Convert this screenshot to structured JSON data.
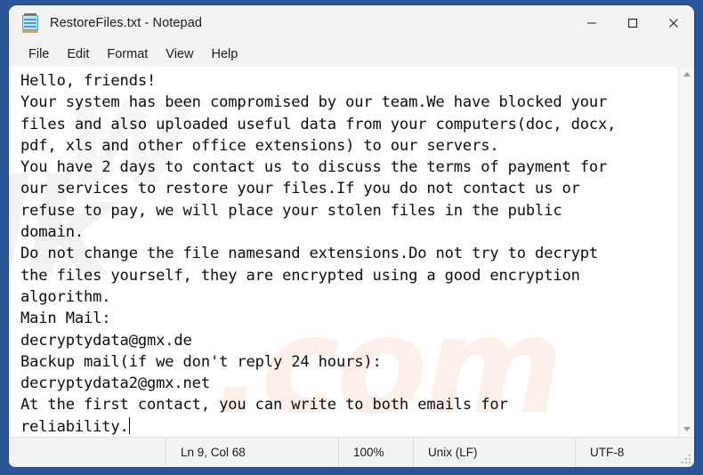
{
  "window": {
    "title": "RestoreFiles.txt - Notepad",
    "app_icon": "notepad-icon",
    "controls": {
      "minimize": "minimize-icon",
      "maximize": "maximize-icon",
      "close": "close-icon"
    }
  },
  "menubar": {
    "items": [
      {
        "label": "File"
      },
      {
        "label": "Edit"
      },
      {
        "label": "Format"
      },
      {
        "label": "View"
      },
      {
        "label": "Help"
      }
    ]
  },
  "editor": {
    "content": "Hello, friends!\nYour system has been compromised by our team.We have blocked your files and also uploaded useful data from your computers(doc, docx, pdf, xls and other office extensions) to our servers.\nYou have 2 days to contact us to discuss the terms of payment for our services to restore your files.If you do not contact us or refuse to pay, we will place your stolen files in the public domain.\nDo not change the file namesand extensions.Do not try to decrypt the files yourself, they are encrypted using a good encryption algorithm.\nMain Mail:\ndecryptydata@gmx.de\nBackup mail(if we don't reply 24 hours):\ndecryptydata2@gmx.net\nAt the first contact, you can write to both emails for reliability.",
    "wrapped_lines": [
      "Hello, friends!",
      "Your system has been compromised by our team.We have blocked your",
      "files and also uploaded useful data from your computers(doc, docx,",
      "pdf, xls and other office extensions) to our servers.",
      "You have 2 days to contact us to discuss the terms of payment for",
      "our services to restore your files.If you do not contact us or",
      "refuse to pay, we will place your stolen files in the public",
      "domain.",
      "Do not change the file namesand extensions.Do not try to decrypt",
      "the files yourself, they are encrypted using a good encryption",
      "algorithm.",
      "Main Mail:",
      "decryptydata@gmx.de",
      "Backup mail(if we don't reply 24 hours):",
      "decryptydata2@gmx.net",
      "At the first contact, you can write to both emails for",
      "reliability."
    ],
    "watermark": {
      "text_a": "lk",
      "text_b": ".com",
      "text_c": "W"
    }
  },
  "scrollbar": {
    "up_arrow": "scroll-up-icon",
    "down_arrow": "scroll-down-icon"
  },
  "statusbar": {
    "line_col": "Ln 9, Col 68",
    "zoom": "100%",
    "line_ending": "Unix (LF)",
    "encoding": "UTF-8"
  },
  "colors": {
    "desktop_blue": "#2a5699",
    "window_chrome": "#f3f3f3",
    "editor_bg": "#ffffff",
    "text": "#0d0d0d",
    "icon_blue": "#4a9ed0"
  }
}
